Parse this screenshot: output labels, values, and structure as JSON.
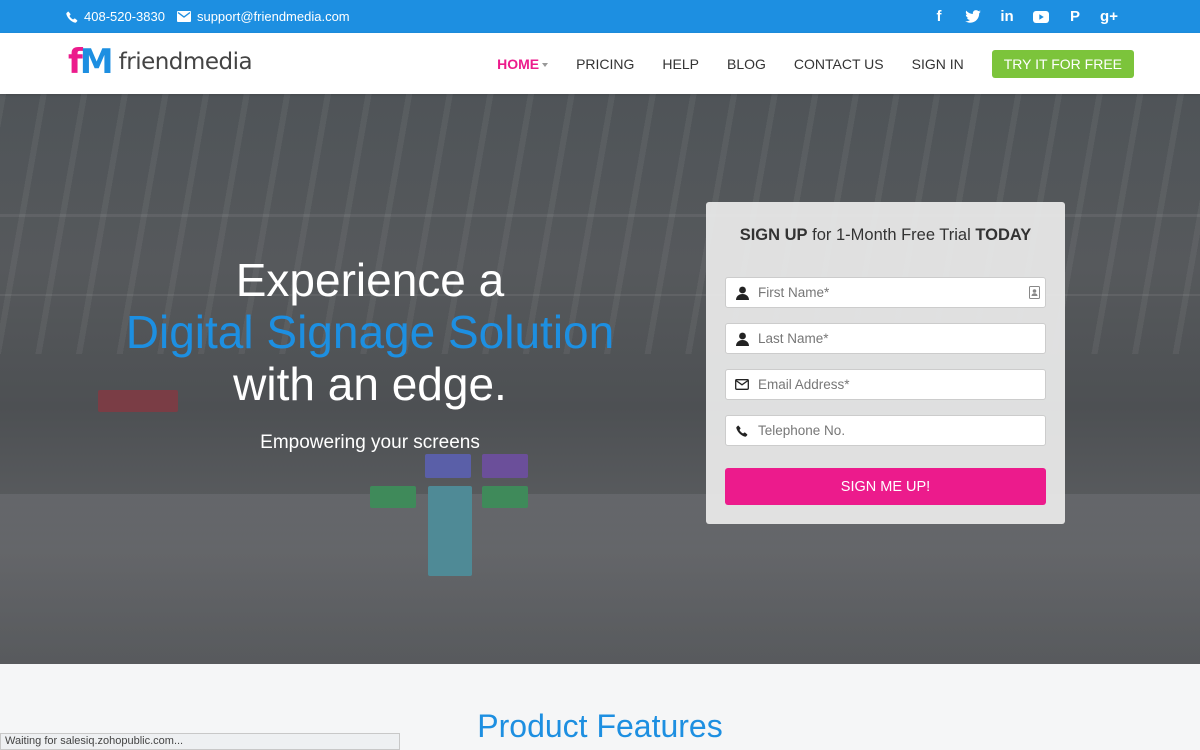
{
  "topbar": {
    "phone": "408-520-3830",
    "email": "support@friendmedia.com",
    "social": [
      {
        "icon": "facebook-icon",
        "glyph": "f"
      },
      {
        "icon": "twitter-icon",
        "glyph": ""
      },
      {
        "icon": "linkedin-icon",
        "glyph": "in"
      },
      {
        "icon": "youtube-icon",
        "glyph": ""
      },
      {
        "icon": "pinterest-icon",
        "glyph": "P"
      },
      {
        "icon": "google-plus-icon",
        "glyph": "g+"
      }
    ]
  },
  "logo": {
    "mark_f": "f",
    "mark_m": "M",
    "word": "friendmedia"
  },
  "nav": {
    "items": [
      "HOME",
      "PRICING",
      "HELP",
      "BLOG",
      "CONTACT US",
      "SIGN IN"
    ],
    "cta": "TRY IT FOR FREE"
  },
  "hero": {
    "line1": "Experience a",
    "line2": "Digital Signage Solution",
    "line3": "with an edge.",
    "subtitle": "Empowering your screens"
  },
  "signup": {
    "title_bold1": "SIGN UP",
    "title_mid": " for 1-Month Free Trial ",
    "title_bold2": "TODAY",
    "first_name_placeholder": "First Name*",
    "last_name_placeholder": "Last Name*",
    "email_placeholder": "Email Address*",
    "phone_placeholder": "Telephone No.",
    "submit": "SIGN ME UP!"
  },
  "features": {
    "title": "Product Features"
  },
  "status": {
    "text": "Waiting for salesiq.zohopublic.com..."
  },
  "colors": {
    "blue": "#1d8fe1",
    "pink": "#ec1b8c",
    "green": "#7cc43b"
  }
}
